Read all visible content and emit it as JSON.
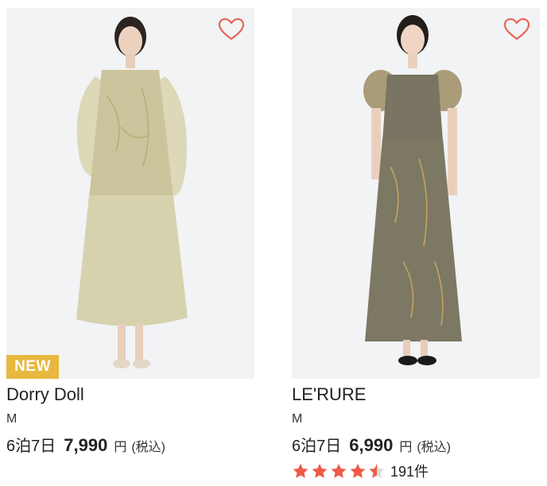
{
  "products": [
    {
      "brand": "Dorry Doll",
      "size": "M",
      "plan": "6泊7日",
      "price": "7,990",
      "currency": "円",
      "tax_note": "(税込)",
      "badge": "NEW",
      "favorite_icon": "heart-outline-icon",
      "dress_color": "#cfc8a0",
      "rating": null
    },
    {
      "brand": "LE'RURE",
      "size": "M",
      "plan": "6泊7日",
      "price": "6,990",
      "currency": "円",
      "tax_note": "(税込)",
      "badge": null,
      "favorite_icon": "heart-outline-icon",
      "dress_color": "#7d7864",
      "rating": {
        "stars": 4.5,
        "count": "191件"
      }
    }
  ],
  "colors": {
    "heart": "#e8655c",
    "star": "#ee5a45",
    "badge_bg": "#e8b83f",
    "photo_bg": "#f2f3f5"
  }
}
